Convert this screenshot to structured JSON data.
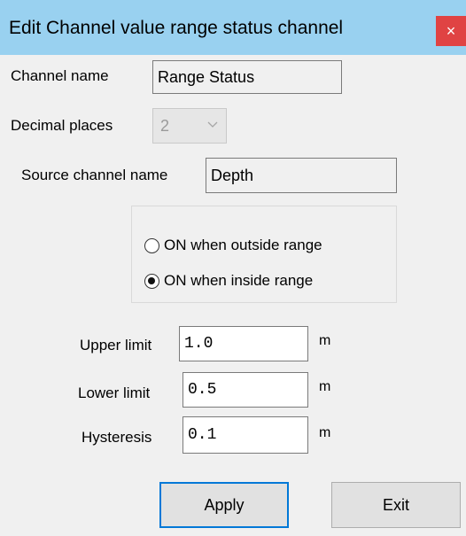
{
  "window": {
    "title": "Edit Channel value range status channel",
    "close_glyph": "×",
    "close_icon": "close-icon"
  },
  "form": {
    "channel_name_label": "Channel name",
    "channel_name_value": "Range Status",
    "decimal_places_label": "Decimal places",
    "decimal_places_value": "2",
    "source_channel_label": "Source channel name",
    "source_channel_value": "Depth",
    "radio_outside_label": "ON when outside range",
    "radio_inside_label": "ON when inside range",
    "selected_radio": "inside",
    "upper_limit_label": "Upper limit",
    "upper_limit_value": "1.0",
    "upper_limit_unit": "m",
    "lower_limit_label": "Lower limit",
    "lower_limit_value": "0.5",
    "lower_limit_unit": "m",
    "hysteresis_label": "Hysteresis",
    "hysteresis_value": "0.1",
    "hysteresis_unit": "m"
  },
  "buttons": {
    "apply_label": "Apply",
    "exit_label": "Exit"
  },
  "colors": {
    "title_bar": "#99d1f0",
    "close_button": "#e04343",
    "focus_border": "#0078d7"
  }
}
